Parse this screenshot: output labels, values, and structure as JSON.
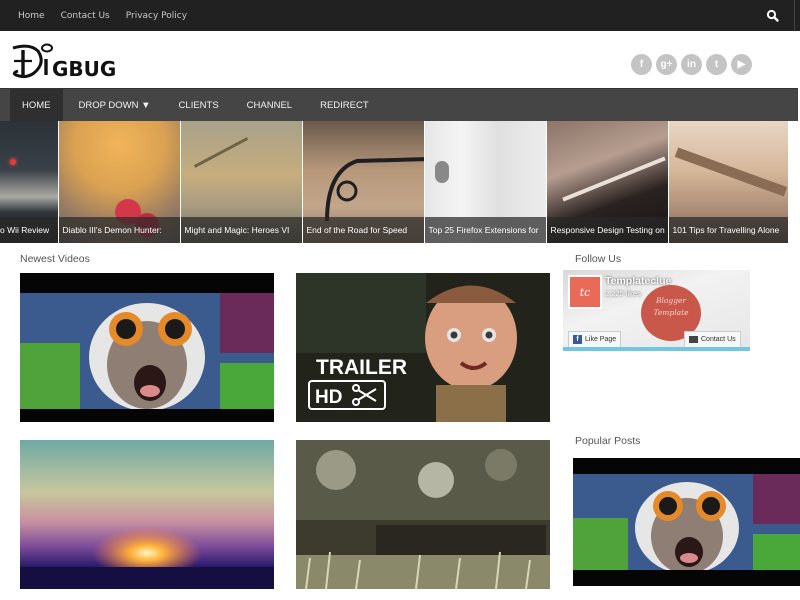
{
  "topbar": {
    "links": [
      "Home",
      "Contact Us",
      "Privacy Policy"
    ],
    "search_icon": "search-icon"
  },
  "header": {
    "logo_text": "DIGBUG",
    "social": [
      {
        "name": "facebook",
        "glyph": "f"
      },
      {
        "name": "google-plus",
        "glyph": "g+"
      },
      {
        "name": "linkedin",
        "glyph": "in"
      },
      {
        "name": "tumblr",
        "glyph": "t"
      },
      {
        "name": "youtube",
        "glyph": "▶"
      }
    ]
  },
  "nav": {
    "items": [
      "HOME",
      "DROP DOWN ▼",
      "CLIENTS",
      "CHANNEL",
      "REDIRECT"
    ],
    "active": "HOME"
  },
  "slider": {
    "slides": [
      "o Wii Review",
      "Diablo III's Demon Hunter:",
      "Might and Magic: Heroes VI",
      "End of the Road for Speed",
      "Top 25 Firefox Extensions for",
      "Responsive Design Testing on",
      "101 Tips for Travelling Alone"
    ]
  },
  "main": {
    "section_title": "Newest Videos",
    "trailer_text": "TRAILER",
    "hd_text": "HD"
  },
  "sidebar": {
    "follow_title": "Follow Us",
    "fb_page_name": "Templateclue",
    "fb_likes": "2,225 likes",
    "fb_avatar_text": "tc",
    "fb_cover_text_1": "Blogger",
    "fb_cover_text_2": "Template",
    "like_button": "Like Page",
    "contact_button": "Contact Us",
    "popular_title": "Popular Posts"
  }
}
